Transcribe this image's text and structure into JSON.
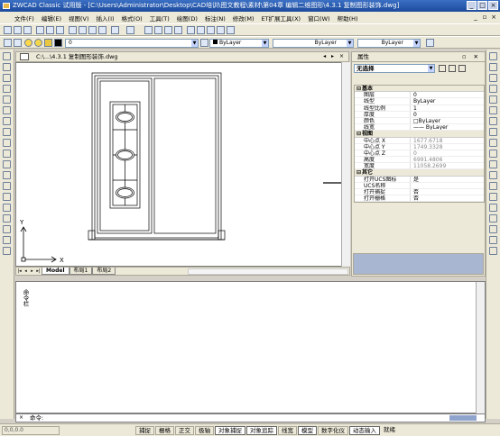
{
  "window": {
    "title": "ZWCAD Classic 试用版 - [C:\\Users\\Administrator\\Desktop\\CAD培训\\图文教程\\素材\\第04章 编辑二维图形\\4.3.1 复制图形装饰.dwg]"
  },
  "menu": [
    "文件(F)",
    "编辑(E)",
    "视图(V)",
    "插入(I)",
    "格式(O)",
    "工具(T)",
    "绘图(D)",
    "标注(N)",
    "修改(M)",
    "ET扩展工具(X)",
    "窗口(W)",
    "帮助(H)"
  ],
  "toolbar2": {
    "layer_value": "0",
    "color_value": "ByLayer",
    "linetype_value": "ByLayer",
    "lineweight_value": "ByLayer"
  },
  "document": {
    "tab_title": "C:\\...\\4.3.1 复制图形装饰.dwg"
  },
  "ucs": {
    "y_label": "Y",
    "x_label": "X"
  },
  "layouts": [
    "Model",
    "布局1",
    "布局2"
  ],
  "properties": {
    "title": "属性",
    "selection": "无选择",
    "categories": [
      {
        "name": "基本",
        "rows": [
          {
            "key": "图层",
            "value": "0"
          },
          {
            "key": "线型",
            "value": "ByLayer"
          },
          {
            "key": "线型比例",
            "value": "1"
          },
          {
            "key": "厚度",
            "value": "0"
          },
          {
            "key": "颜色",
            "value": "□ByLayer"
          },
          {
            "key": "线宽",
            "value": "—— ByLayer"
          }
        ]
      },
      {
        "name": "视图",
        "rows": [
          {
            "key": "中心点 X",
            "value": "1677.6718",
            "grey": true
          },
          {
            "key": "中心点 Y",
            "value": "1749.3328",
            "grey": true
          },
          {
            "key": "中心点 Z",
            "value": "0",
            "grey": true
          },
          {
            "key": "高度",
            "value": "6991.4806",
            "grey": true
          },
          {
            "key": "宽度",
            "value": "11058.2699",
            "grey": true
          }
        ]
      },
      {
        "name": "其它",
        "rows": [
          {
            "key": "打开UCS图标",
            "value": "是"
          },
          {
            "key": "UCS名称",
            "value": ""
          },
          {
            "key": "打开捕捉",
            "value": "否"
          },
          {
            "key": "打开栅格",
            "value": "否"
          }
        ]
      }
    ]
  },
  "command": {
    "panel_label": "命令栏",
    "prompt": "命令:"
  },
  "status": {
    "coords": "0,0,0.0",
    "buttons": [
      {
        "label": "捕捉",
        "on": false
      },
      {
        "label": "栅格",
        "on": false
      },
      {
        "label": "正交",
        "on": false
      },
      {
        "label": "极轴",
        "on": false
      },
      {
        "label": "对象捕捉",
        "on": true
      },
      {
        "label": "对象追踪",
        "on": true
      },
      {
        "label": "线宽",
        "on": false
      },
      {
        "label": "模型",
        "on": true
      },
      {
        "label": "数字化仪",
        "on": false
      },
      {
        "label": "动态输入",
        "on": true
      },
      {
        "label": "就绪",
        "on": false
      }
    ]
  }
}
